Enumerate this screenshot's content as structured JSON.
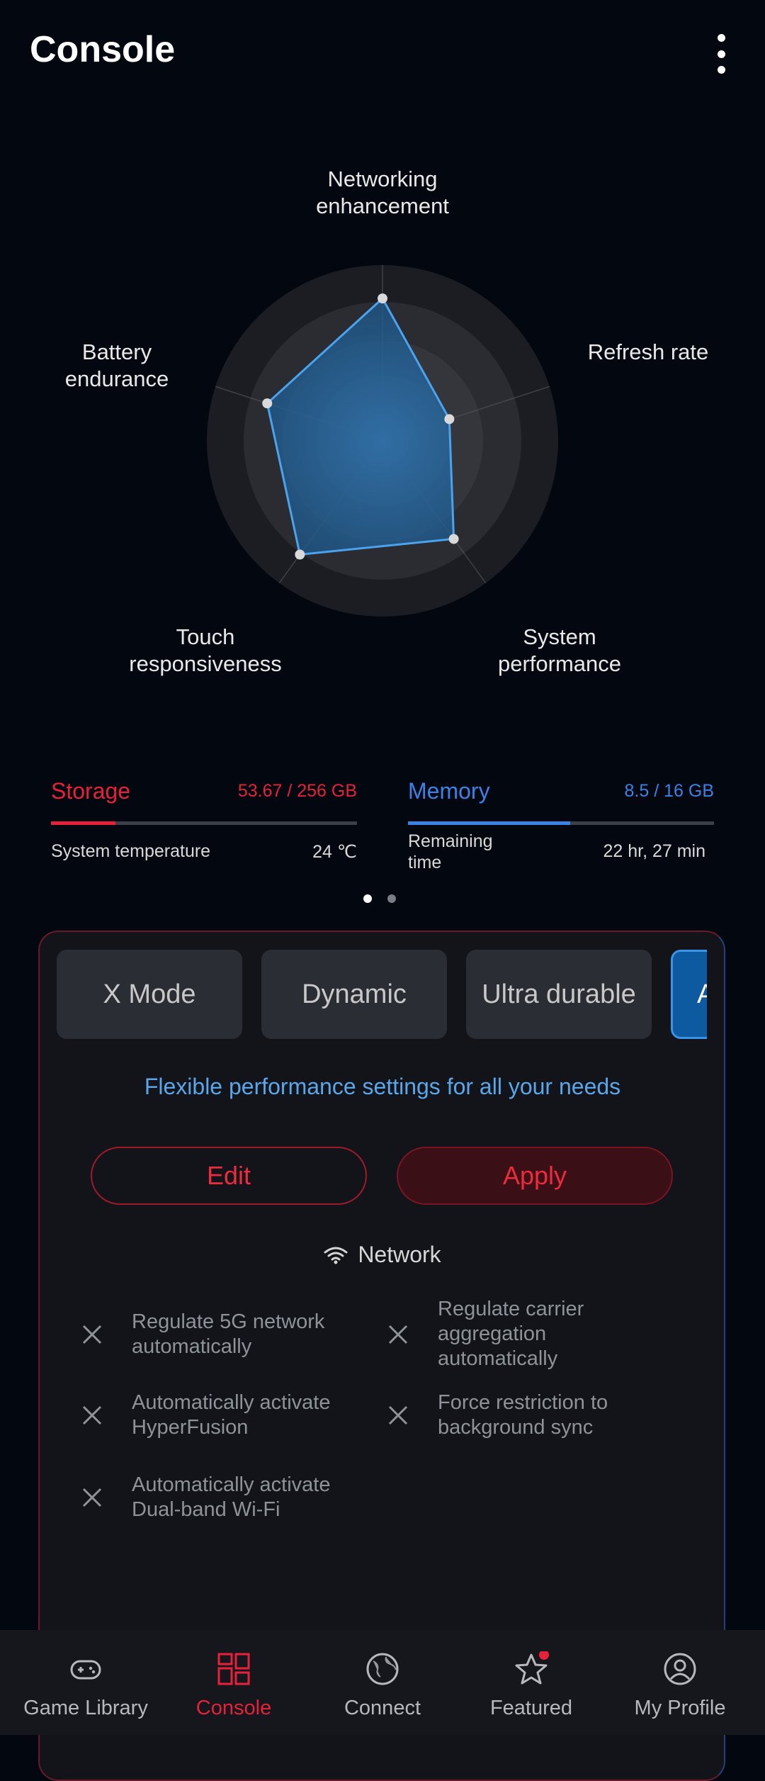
{
  "header": {
    "title": "Console"
  },
  "radar": {
    "axes": [
      {
        "label": "Networking enhancement",
        "value": 0.81
      },
      {
        "label": "Refresh rate",
        "value": 0.4
      },
      {
        "label": "System performance",
        "value": 0.69
      },
      {
        "label": "Touch responsiveness",
        "value": 0.8
      },
      {
        "label": "Battery endurance",
        "value": 0.69
      }
    ],
    "label_lines": {
      "networking_1": "Networking",
      "networking_2": "enhancement",
      "refresh": "Refresh rate",
      "system_1": "System",
      "system_2": "performance",
      "touch_1": "Touch",
      "touch_2": "responsiveness",
      "battery_1": "Battery",
      "battery_2": "endurance"
    }
  },
  "stats": {
    "storage": {
      "label": "Storage",
      "value": "53.67 / 256 GB",
      "fraction": 0.21,
      "color": "#e8203a"
    },
    "memory": {
      "label": "Memory",
      "value": "8.5 / 16 GB",
      "fraction": 0.53,
      "color": "#3b82e6"
    },
    "temperature": {
      "label": "System temperature",
      "value": "24 ℃"
    },
    "remaining": {
      "label_1": "Remaining",
      "label_2": "time",
      "value": "22 hr, 27 min"
    }
  },
  "pager": {
    "page": 1,
    "count": 2
  },
  "modes": {
    "items": [
      "X Mode",
      "Dynamic",
      "Ultra durable",
      "A"
    ],
    "selected_index": 3
  },
  "tagline": "Flexible performance settings for all your needs",
  "actions": {
    "edit": "Edit",
    "apply": "Apply"
  },
  "network": {
    "title": "Network",
    "features": [
      {
        "l1": "Regulate 5G network",
        "l2": "automatically",
        "l3": ""
      },
      {
        "l1": "Regulate carrier",
        "l2": "aggregation",
        "l3": "automatically"
      },
      {
        "l1": "Automatically activate",
        "l2": "HyperFusion",
        "l3": ""
      },
      {
        "l1": "Force restriction to",
        "l2": "background sync",
        "l3": ""
      },
      {
        "l1": "Automatically activate",
        "l2": "Dual-band Wi-Fi",
        "l3": ""
      }
    ]
  },
  "nav": {
    "items": [
      {
        "label": "Game Library",
        "icon": "gamepad-icon"
      },
      {
        "label": "Console",
        "icon": "grid-icon"
      },
      {
        "label": "Connect",
        "icon": "globe-icon"
      },
      {
        "label": "Featured",
        "icon": "star-icon"
      },
      {
        "label": "My Profile",
        "icon": "profile-icon"
      }
    ],
    "active": "Console",
    "accent": "#e8203a"
  }
}
